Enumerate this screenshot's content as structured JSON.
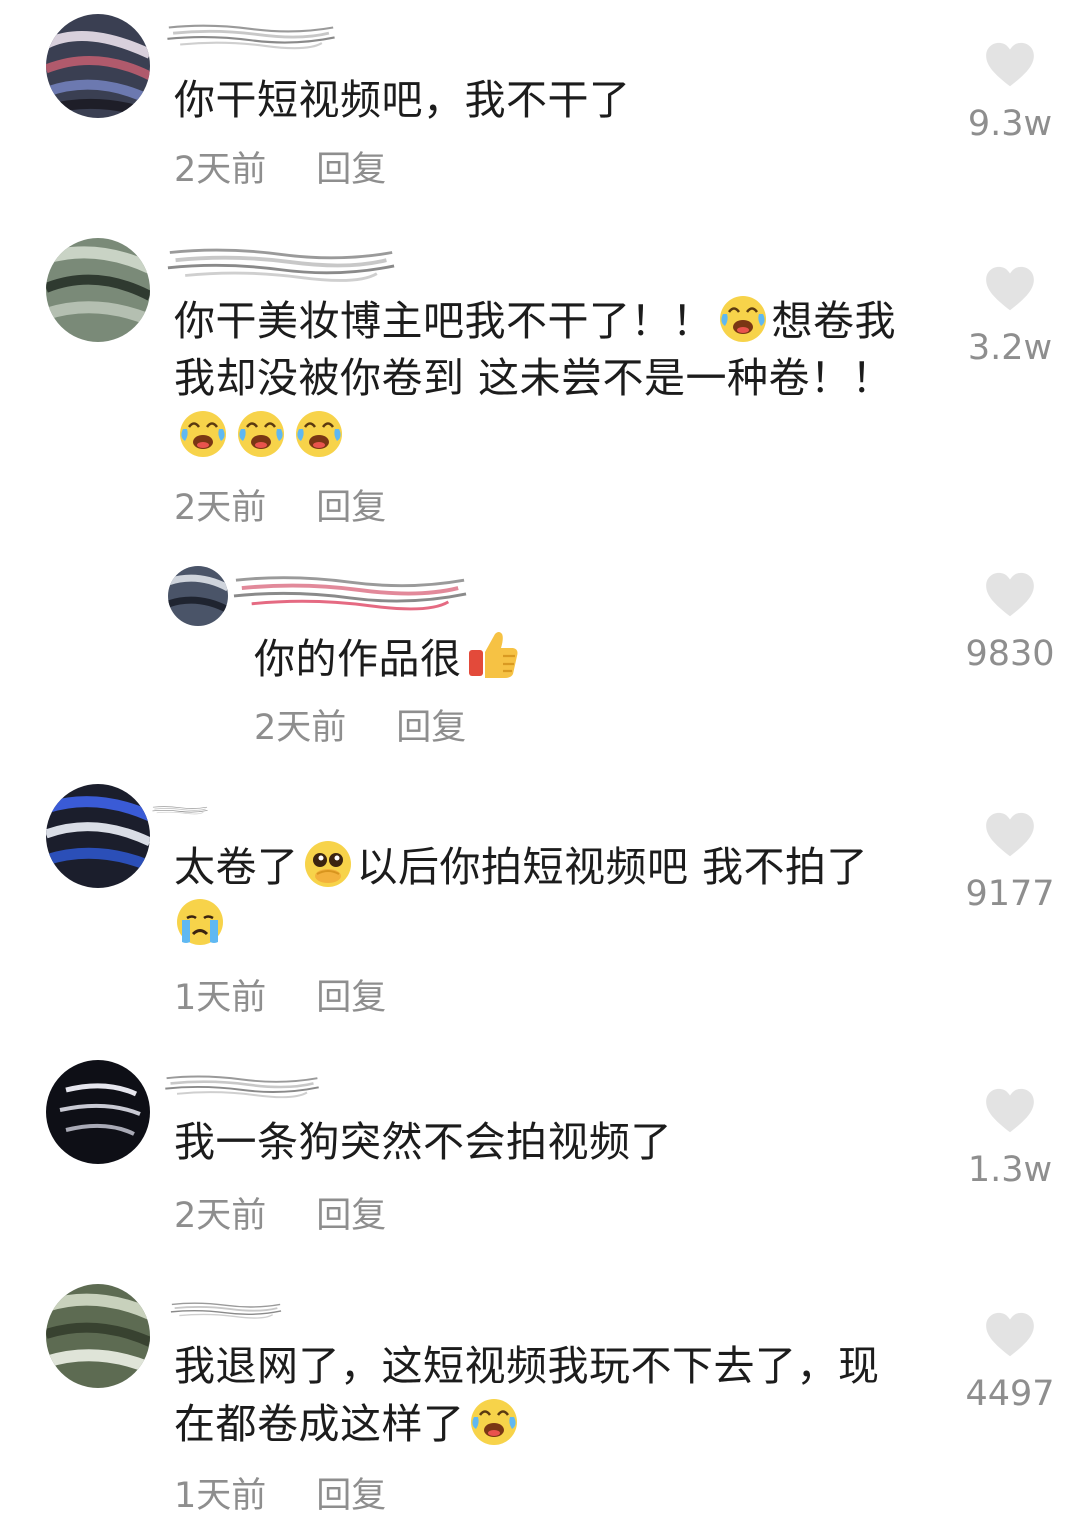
{
  "comments": [
    {
      "text": "你干短视频吧，我不干了",
      "time": "2天前",
      "reply": "回复",
      "likes": "9.3w"
    },
    {
      "text_parts": [
        "你干美妆博主吧我不干了！！",
        "想卷我我却没被你卷到 这未尝不是一种卷！！"
      ],
      "time": "2天前",
      "reply": "回复",
      "likes": "3.2w"
    },
    {
      "text": "你的作品很",
      "time": "2天前",
      "reply": "回复",
      "likes": "9830"
    },
    {
      "text_parts": [
        "太卷了",
        "以后你拍短视频吧 我不拍了"
      ],
      "time": "1天前",
      "reply": "回复",
      "likes": "9177"
    },
    {
      "text": "我一条狗突然不会拍视频了",
      "time": "2天前",
      "reply": "回复",
      "likes": "1.3w"
    },
    {
      "text": "我退网了，这短视频我玩不下去了，现在都卷成这样了",
      "time": "1天前",
      "reply": "回复",
      "likes": "4497"
    }
  ],
  "icons": {
    "like": "heart-icon",
    "emoji_laugh_cry": "laughing-crying-face",
    "emoji_pleading": "pleading-face",
    "emoji_crying": "crying-face",
    "emoji_thumbs_up": "thumbs-up"
  },
  "colors": {
    "text": "#1c1c1c",
    "meta": "#8e8e8e",
    "heart": "#e3e3e3"
  }
}
